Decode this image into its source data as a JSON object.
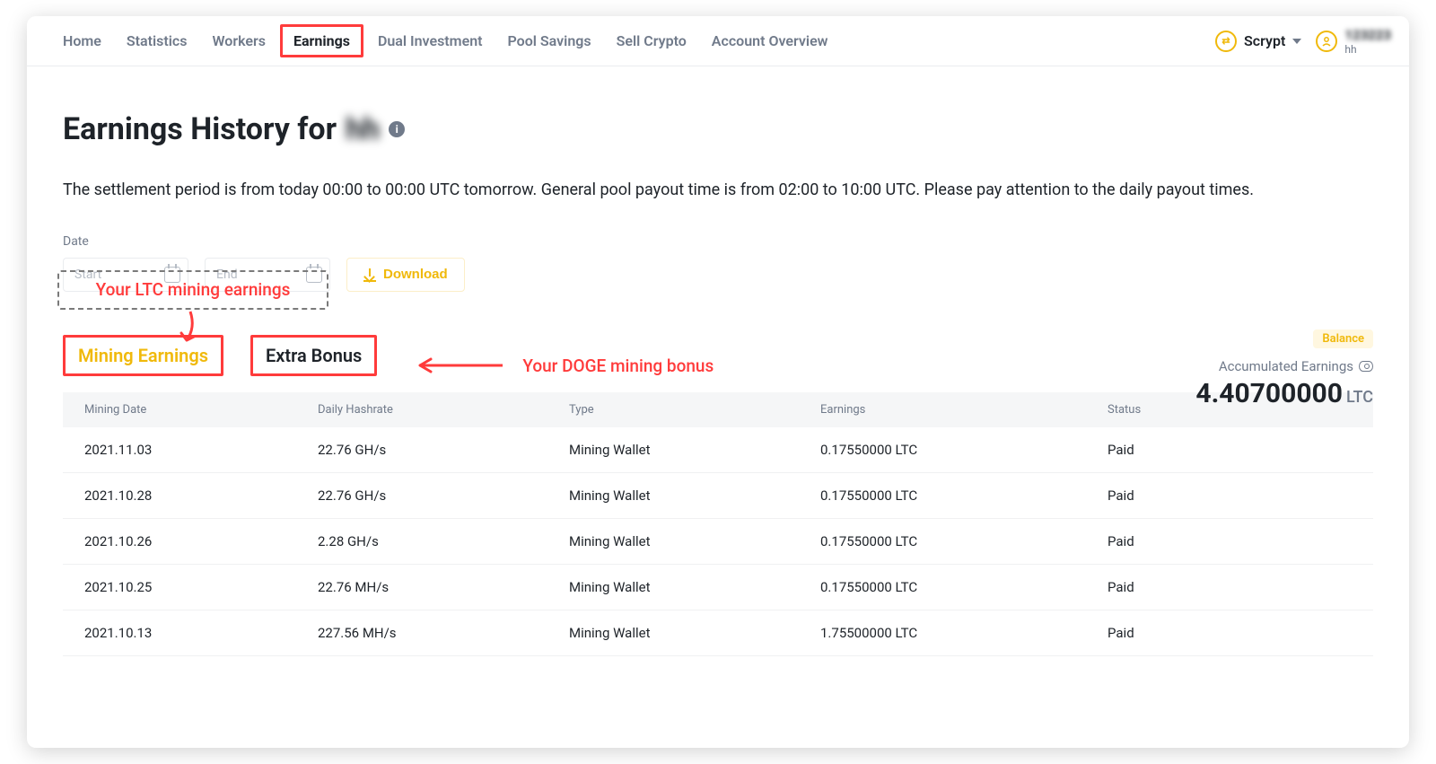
{
  "nav": {
    "items": [
      {
        "label": "Home"
      },
      {
        "label": "Statistics"
      },
      {
        "label": "Workers"
      },
      {
        "label": "Earnings",
        "active": true,
        "highlighted": true
      },
      {
        "label": "Dual Investment"
      },
      {
        "label": "Pool Savings"
      },
      {
        "label": "Sell Crypto"
      },
      {
        "label": "Account Overview"
      }
    ]
  },
  "topbar": {
    "algo_label": "Scrypt",
    "user_num": "123223",
    "user_sub": "hh"
  },
  "page": {
    "title_prefix": "Earnings History for ",
    "title_user": "hh",
    "description": "The settlement period is from today 00:00 to 00:00 UTC tomorrow. General pool payout time is from 02:00 to 10:00 UTC. Please pay attention to the daily payout times.",
    "date_label": "Date",
    "start_placeholder": "Start",
    "end_placeholder": "End",
    "download_label": "Download"
  },
  "callouts": {
    "ltc_earnings": "Your LTC mining earnings",
    "doge_bonus": "Your DOGE mining bonus"
  },
  "tabs": {
    "mining_earnings": "Mining Earnings",
    "extra_bonus": "Extra Bonus"
  },
  "balance": {
    "badge": "Balance",
    "label": "Accumulated Earnings",
    "value": "4.40700000",
    "unit": "LTC"
  },
  "table": {
    "headers": {
      "date": "Mining Date",
      "hashrate": "Daily Hashrate",
      "type": "Type",
      "earnings": "Earnings",
      "status": "Status"
    },
    "rows": [
      {
        "date": "2021.11.03",
        "hashrate": "22.76 GH/s",
        "type": "Mining Wallet",
        "earnings": "0.17550000 LTC",
        "status": "Paid"
      },
      {
        "date": "2021.10.28",
        "hashrate": "22.76 GH/s",
        "type": "Mining Wallet",
        "earnings": "0.17550000 LTC",
        "status": "Paid"
      },
      {
        "date": "2021.10.26",
        "hashrate": "2.28 GH/s",
        "type": "Mining Wallet",
        "earnings": "0.17550000 LTC",
        "status": "Paid"
      },
      {
        "date": "2021.10.25",
        "hashrate": "22.76 MH/s",
        "type": "Mining Wallet",
        "earnings": "0.17550000 LTC",
        "status": "Paid"
      },
      {
        "date": "2021.10.13",
        "hashrate": "227.56 MH/s",
        "type": "Mining Wallet",
        "earnings": "1.75500000 LTC",
        "status": "Paid"
      }
    ]
  }
}
